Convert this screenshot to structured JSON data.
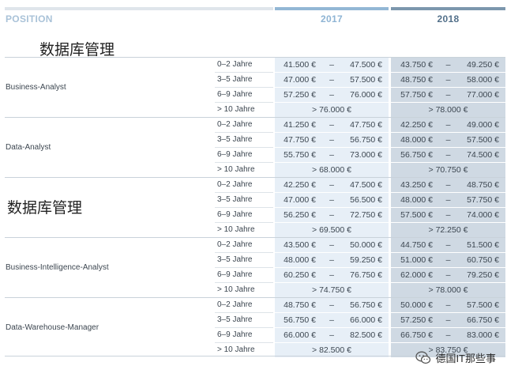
{
  "header": {
    "position_label": "POSITION",
    "year1": "2017",
    "year2": "2018"
  },
  "watermarks": [
    "数据库管理",
    "数据库管理"
  ],
  "roles": [
    {
      "name": "Business-Analyst",
      "rows": [
        {
          "exp": "0–2 Jahre",
          "y2017": [
            "41.500 €",
            "47.500 €"
          ],
          "y2018": [
            "43.750 €",
            "49.250 €"
          ]
        },
        {
          "exp": "3–5 Jahre",
          "y2017": [
            "47.000 €",
            "57.500 €"
          ],
          "y2018": [
            "48.750 €",
            "58.000 €"
          ]
        },
        {
          "exp": "6–9 Jahre",
          "y2017": [
            "57.250 €",
            "76.000 €"
          ],
          "y2018": [
            "57.750 €",
            "77.000 €"
          ]
        },
        {
          "exp": "> 10 Jahre",
          "y2017": [
            "> 76.000 €"
          ],
          "y2018": [
            "> 78.000 €"
          ]
        }
      ]
    },
    {
      "name": "Data-Analyst",
      "rows": [
        {
          "exp": "0–2 Jahre",
          "y2017": [
            "41.250 €",
            "47.750 €"
          ],
          "y2018": [
            "42.250 €",
            "49.000 €"
          ]
        },
        {
          "exp": "3–5 Jahre",
          "y2017": [
            "47.750 €",
            "56.750 €"
          ],
          "y2018": [
            "48.000 €",
            "57.500 €"
          ]
        },
        {
          "exp": "6–9 Jahre",
          "y2017": [
            "55.750 €",
            "73.000 €"
          ],
          "y2018": [
            "56.750 €",
            "74.500 €"
          ]
        },
        {
          "exp": "> 10 Jahre",
          "y2017": [
            "> 68.000 €"
          ],
          "y2018": [
            "> 70.750 €"
          ]
        }
      ]
    },
    {
      "name": "",
      "rows": [
        {
          "exp": "0–2 Jahre",
          "y2017": [
            "42.250 €",
            "47.500 €"
          ],
          "y2018": [
            "43.250 €",
            "48.750 €"
          ]
        },
        {
          "exp": "3–5 Jahre",
          "y2017": [
            "47.000 €",
            "56.500 €"
          ],
          "y2018": [
            "48.000 €",
            "57.750 €"
          ]
        },
        {
          "exp": "6–9 Jahre",
          "y2017": [
            "56.250 €",
            "72.750 €"
          ],
          "y2018": [
            "57.500 €",
            "74.000 €"
          ]
        },
        {
          "exp": "> 10 Jahre",
          "y2017": [
            "> 69.500 €"
          ],
          "y2018": [
            "> 72.250 €"
          ]
        }
      ]
    },
    {
      "name": "Business-Intelligence-Analyst",
      "rows": [
        {
          "exp": "0–2 Jahre",
          "y2017": [
            "43.500 €",
            "50.000 €"
          ],
          "y2018": [
            "44.750 €",
            "51.500 €"
          ]
        },
        {
          "exp": "3–5 Jahre",
          "y2017": [
            "48.000 €",
            "59.250 €"
          ],
          "y2018": [
            "51.000 €",
            "60.750 €"
          ]
        },
        {
          "exp": "6–9 Jahre",
          "y2017": [
            "60.250 €",
            "76.750 €"
          ],
          "y2018": [
            "62.000 €",
            "79.250 €"
          ]
        },
        {
          "exp": "> 10 Jahre",
          "y2017": [
            "> 74.750 €"
          ],
          "y2018": [
            "> 78.000 €"
          ]
        }
      ]
    },
    {
      "name": "Data-Warehouse-Manager",
      "rows": [
        {
          "exp": "0–2 Jahre",
          "y2017": [
            "48.750 €",
            "56.750 €"
          ],
          "y2018": [
            "50.000 €",
            "57.500 €"
          ]
        },
        {
          "exp": "3–5 Jahre",
          "y2017": [
            "56.750 €",
            "66.000 €"
          ],
          "y2018": [
            "57.250 €",
            "66.750 €"
          ]
        },
        {
          "exp": "6–9 Jahre",
          "y2017": [
            "66.000 €",
            "82.500 €"
          ],
          "y2018": [
            "66.750 €",
            "83.000 €"
          ]
        },
        {
          "exp": "> 10 Jahre",
          "y2017": [
            "> 82.500 €"
          ],
          "y2018": [
            "> 83.750 €"
          ]
        }
      ]
    }
  ],
  "brand": {
    "icon": "wechat-icon",
    "text": "德国IT那些事"
  }
}
